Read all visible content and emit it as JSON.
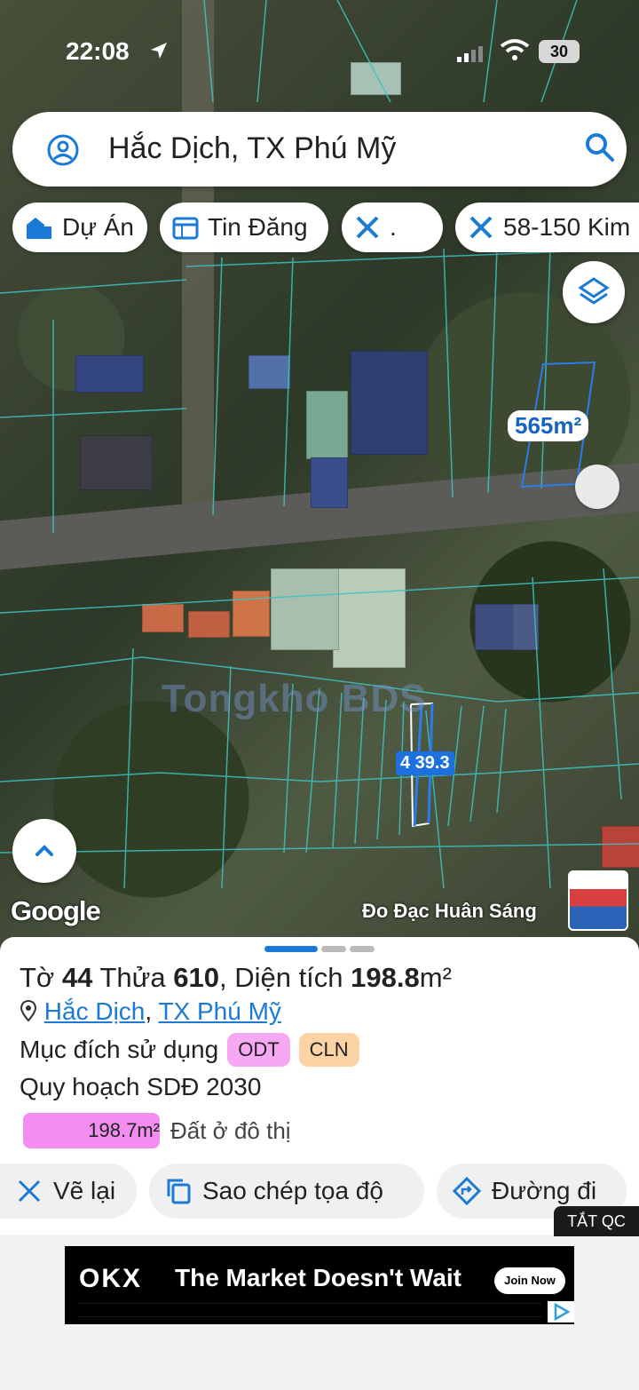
{
  "status_bar": {
    "time": "22:08",
    "battery": "30"
  },
  "search": {
    "query": "Hắc Dịch, TX Phú Mỹ"
  },
  "filter_chips": [
    {
      "label": "Dự Án",
      "icon": "building-icon"
    },
    {
      "label": "Tin Đăng",
      "icon": "calendar-icon"
    },
    {
      "label": ".",
      "icon": "ruler-icon"
    },
    {
      "label": "58-150 Kim",
      "icon": "ruler-icon"
    }
  ],
  "map": {
    "area_tag": "565m²",
    "watermark": "Tongkho BDS",
    "plot_label": "4 39.3",
    "google_label": "Google",
    "credit": "Đo Đạc Huân Sáng"
  },
  "parcel": {
    "to_word": "Tờ",
    "to_value": "44",
    "thua_word": "Thửa",
    "thua_value": "610",
    "dien_tich_word": "Diện tích",
    "area_value": "198.8",
    "area_unit": "m²",
    "ward": "Hắc Dịch",
    "separator": ",",
    "town": "TX Phú Mỹ",
    "purpose_label": "Mục đích sử dụng",
    "purpose_tags": [
      {
        "code": "ODT",
        "color": "#f6a8f3"
      },
      {
        "code": "CLN",
        "color": "#fbd3a4"
      }
    ],
    "plan_label": "Quy hoạch SDĐ 2030",
    "plan_bar_value": "198.7m²",
    "plan_bar_label": "Đất ở đô thị",
    "plan_bar_color": "#f38ef0"
  },
  "actions": [
    {
      "label": "Vẽ lại",
      "icon": "ruler-icon"
    },
    {
      "label": "Sao chép tọa độ",
      "icon": "copy-icon"
    },
    {
      "label": "Đường đi",
      "icon": "directions-icon"
    }
  ],
  "ad": {
    "off_label": "TẮT QC",
    "brand": "OKX",
    "headline": "The Market Doesn't Wait",
    "cta": "Join Now"
  },
  "colors": {
    "accent": "#1a7ad6",
    "plot_blue": "#1e6fe0"
  }
}
